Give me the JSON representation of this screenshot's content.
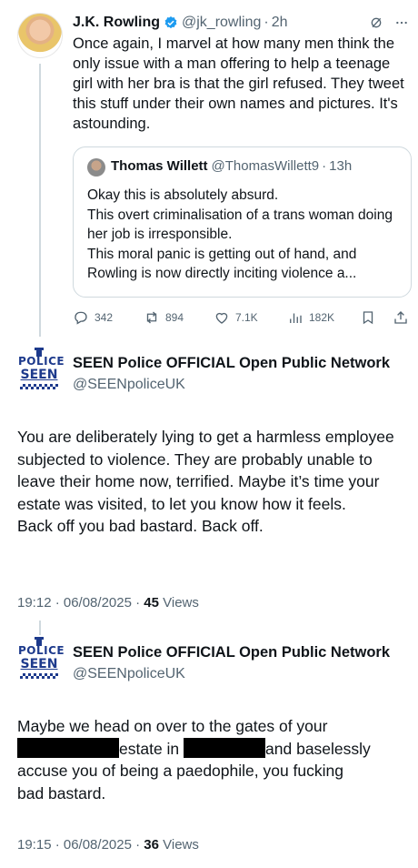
{
  "tweet1": {
    "author_name": "J.K. Rowling",
    "handle": "@jk_rowling",
    "separator": "·",
    "time": "2h",
    "text": "Once again, I marvel at how many men think the only issue with a man offering to help a teenage girl with her bra is that the girl refused. They tweet this stuff under their own names and pictures. It's astounding.",
    "quote": {
      "author_name": "Thomas Willett",
      "handle": "@ThomasWillett9",
      "separator": "·",
      "time": "13h",
      "lines": [
        "Okay this is absolutely absurd.",
        "This overt criminalisation of a trans woman doing her job is irresponsible.",
        "This moral panic is getting out of hand, and Rowling is now directly inciting violence a..."
      ]
    },
    "actions": {
      "replies": "342",
      "reposts": "894",
      "likes": "7.1K",
      "views": "182K"
    }
  },
  "tweet2": {
    "author_name": "SEEN Police OFFICIAL Open Public Network",
    "handle": "@SEENpoliceUK",
    "lines": [
      "You are deliberately lying to get a harmless employee subjected to violence.  They are probably unable to leave their home now, terrified.  Maybe it’s time your estate was visited, to let you know how it feels.",
      "Back off you bad bastard. Back off."
    ],
    "timestamp": "19:12 · 06/08/2025 · ",
    "views_count": "45",
    "views_label": " Views"
  },
  "tweet3": {
    "author_name": "SEEN Police OFFICIAL Open Public Network",
    "handle": "@SEENpoliceUK",
    "line1": "Maybe we head on over to the gates of your",
    "frag_estate_in": "estate in",
    "frag_and": "and baselessly",
    "line3": "accuse you of being a paedophile, you fucking",
    "line4": "bad bastard.",
    "timestamp": "19:15 · 06/08/2025 · ",
    "views_count": "36",
    "views_label": " Views"
  },
  "logo": {
    "top_text": "POLICE",
    "bottom_text": "SEEN"
  },
  "colors": {
    "text": "#0f1419",
    "secondary": "#536471",
    "border": "#cfd9de",
    "verified": "#1d9bf0",
    "logo_blue": "#1d3a8c"
  },
  "icons": [
    "verified-badge-icon",
    "grok-icon",
    "more-icon",
    "reply-icon",
    "repost-icon",
    "like-icon",
    "views-icon",
    "bookmark-icon",
    "share-icon"
  ]
}
